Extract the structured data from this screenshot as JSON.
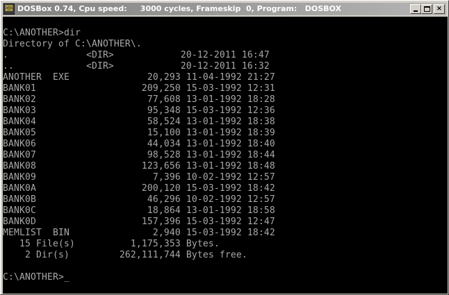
{
  "window": {
    "title": "DOSBox 0.74, Cpu speed:     3000 cycles, Frameskip  0, Program:   DOSBOX",
    "icon_text_top": "DOS",
    "icon_text_bottom": "BOX",
    "icon": "dosbox-icon",
    "buttons": {
      "minimize": "minimize-icon",
      "maximize": "maximize-icon",
      "close": "×"
    }
  },
  "console": {
    "colors": {
      "background": "#000000",
      "text": "#a8a8a8"
    },
    "lines": [
      "C:\\ANOTHER>dir",
      "Directory of C:\\ANOTHER\\.",
      ".              <DIR>            20-12-2011 16:47",
      "..             <DIR>            20-12-2011 16:32",
      "ANOTHER  EXE              20,293 11-04-1992 21:27",
      "BANK01                   209,250 15-03-1992 12:31",
      "BANK02                    77,608 13-01-1992 18:28",
      "BANK03                    95,348 15-03-1992 12:36",
      "BANK04                    58,524 13-01-1992 18:38",
      "BANK05                    15,100 13-01-1992 18:39",
      "BANK06                    44,034 13-01-1992 18:40",
      "BANK07                    98,528 13-01-1992 18:44",
      "BANK08                   123,656 13-01-1992 18:48",
      "BANK09                     7,396 10-02-1992 12:57",
      "BANK0A                   200,120 15-03-1992 18:42",
      "BANK0B                    46,296 10-02-1992 12:57",
      "BANK0C                    18,864 13-01-1992 18:58",
      "BANK0D                   157,396 15-03-1992 12:47",
      "MEMLIST  BIN               2,940 15-03-1992 18:42",
      "   15 File(s)          1,175,353 Bytes.",
      "    2 Dir(s)         262,111,744 Bytes free.",
      "",
      "C:\\ANOTHER>"
    ],
    "cursor": "_"
  }
}
